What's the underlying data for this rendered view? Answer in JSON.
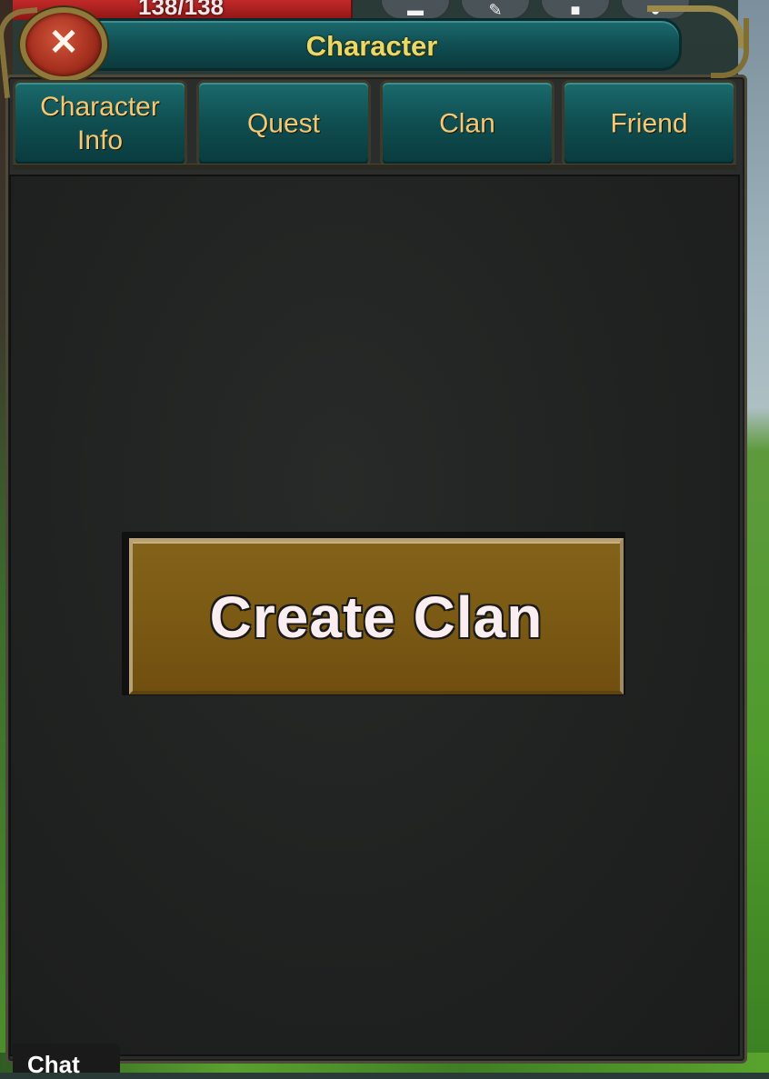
{
  "hud": {
    "hp_text": "138/138",
    "chat_label": "Chat"
  },
  "window": {
    "title": "Character",
    "close_symbol": "✕"
  },
  "tabs": [
    {
      "label": "Character\nInfo",
      "name": "character-info"
    },
    {
      "label": "Quest",
      "name": "quest"
    },
    {
      "label": "Clan",
      "name": "clan"
    },
    {
      "label": "Friend",
      "name": "friend"
    }
  ],
  "clan": {
    "create_button_label": "Create Clan"
  },
  "colors": {
    "title_text": "#e9d86a",
    "tab_text": "#f2c977",
    "button_gold": "#7b5a14",
    "panel_dark": "#202221"
  },
  "icons": [
    "close-icon",
    "menu-icon",
    "book-icon",
    "gift-icon",
    "profile-icon"
  ]
}
